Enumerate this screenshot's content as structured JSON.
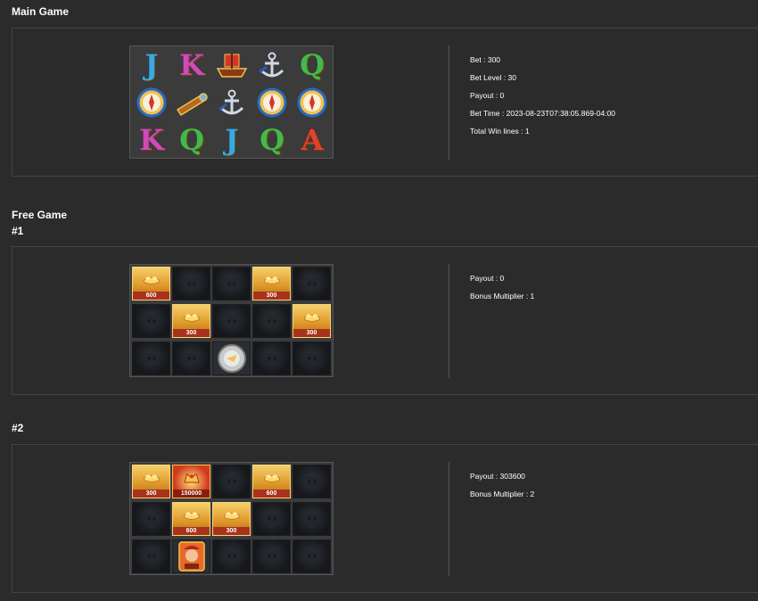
{
  "main_game": {
    "heading": "Main Game",
    "grid": [
      [
        "J",
        "K",
        "ship",
        "anchor",
        "Q"
      ],
      [
        "compass",
        "spyglass",
        "anchor",
        "compass",
        "compass"
      ],
      [
        "K",
        "Q",
        "J",
        "Q",
        "A"
      ]
    ],
    "info": {
      "bet": "Bet : 300",
      "bet_level": "Bet Level : 30",
      "payout": "Payout : 0",
      "bet_time": "Bet Time : 2023-08-23T07:38:05.869-04:00",
      "total_win_lines": "Total Win lines : 1"
    }
  },
  "free_game": {
    "heading": "Free Game",
    "rounds": [
      {
        "label": "#1",
        "grid": [
          [
            {
              "type": "gold",
              "value": "600"
            },
            {
              "type": "dark"
            },
            {
              "type": "dark"
            },
            {
              "type": "gold",
              "value": "300"
            },
            {
              "type": "dark"
            }
          ],
          [
            {
              "type": "dark"
            },
            {
              "type": "gold",
              "value": "300"
            },
            {
              "type": "dark"
            },
            {
              "type": "dark"
            },
            {
              "type": "gold",
              "value": "300"
            }
          ],
          [
            {
              "type": "dark"
            },
            {
              "type": "dark"
            },
            {
              "type": "coin"
            },
            {
              "type": "dark"
            },
            {
              "type": "dark"
            }
          ]
        ],
        "payout": "Payout : 0",
        "bonus_multiplier": "Bonus Multiplier : 1"
      },
      {
        "label": "#2",
        "grid": [
          [
            {
              "type": "gold",
              "value": "300"
            },
            {
              "type": "red",
              "value": "150000"
            },
            {
              "type": "dark"
            },
            {
              "type": "gold",
              "value": "600"
            },
            {
              "type": "dark"
            }
          ],
          [
            {
              "type": "dark"
            },
            {
              "type": "gold",
              "value": "600"
            },
            {
              "type": "gold",
              "value": "300"
            },
            {
              "type": "dark"
            },
            {
              "type": "dark"
            }
          ],
          [
            {
              "type": "dark"
            },
            {
              "type": "pirate"
            },
            {
              "type": "dark"
            },
            {
              "type": "dark"
            },
            {
              "type": "dark"
            }
          ]
        ],
        "payout": "Payout : 303600",
        "bonus_multiplier": "Bonus Multiplier : 2"
      }
    ]
  },
  "colors": {
    "background": "#2b2b2b",
    "panel_border": "#444444",
    "text": "#ffffff"
  }
}
